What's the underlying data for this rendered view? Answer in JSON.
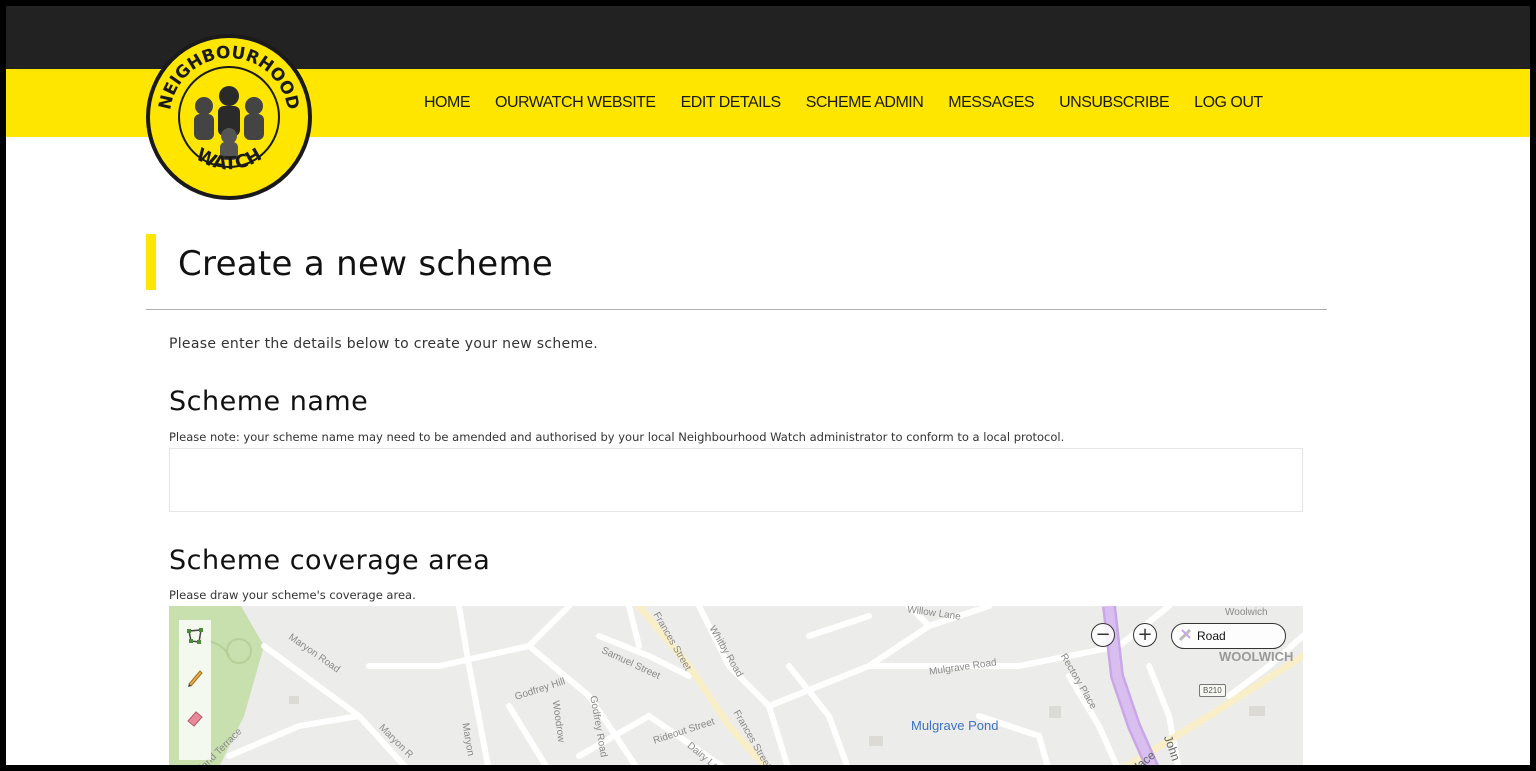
{
  "brand": {
    "logo_text_top": "NEIGHBOURHOOD",
    "logo_text_bottom": "WATCH",
    "colors": {
      "yellow": "#ffe600",
      "dark": "#222222"
    }
  },
  "nav": {
    "items": [
      "HOME",
      "OURWATCH WEBSITE",
      "EDIT DETAILS",
      "SCHEME ADMIN",
      "MESSAGES",
      "UNSUBSCRIBE",
      "LOG OUT"
    ]
  },
  "page": {
    "title": "Create a new scheme",
    "intro": "Please enter the details below to create your new scheme."
  },
  "scheme_name": {
    "heading": "Scheme name",
    "note": "Please note: your scheme name may need to be amended and authorised by your local Neighbourhood Watch administrator to conform to a local protocol.",
    "value": "",
    "placeholder": ""
  },
  "coverage": {
    "heading": "Scheme coverage area",
    "note": "Please draw your scheme's coverage area."
  },
  "map": {
    "map_type": "Road",
    "zoom_out": "−",
    "zoom_in": "+",
    "tools": [
      "polygon-tool-icon",
      "pencil-icon",
      "eraser-icon"
    ],
    "labels": {
      "willow_lane": "Willow Lane",
      "woolwich_small": "Woolwich",
      "woolwich_big": "WOOLWICH",
      "maryon_road_1": "Maryon Road",
      "maryon_road_2": "Maryon R",
      "maryon_road_3": "Maryon",
      "samuel_street": "Samuel Street",
      "frances_street_1": "Frances Street",
      "frances_street_2": "Frances Street",
      "whitby_road": "Whitby Road",
      "mulgrave_road": "Mulgrave Road",
      "rectory_place": "Rectory Place",
      "godfrey_hill": "Godfrey Hill",
      "woodrow": "Woodrow",
      "godfrey_road": "Godfrey Road",
      "rideout_street": "Rideout Street",
      "dairy_lane": "Dairy La",
      "highland_terrace": "dland Terrace",
      "mulgrave_pond": "Mulgrave Pond",
      "b210": "B210",
      "john": "John",
      "place": "Place"
    }
  }
}
